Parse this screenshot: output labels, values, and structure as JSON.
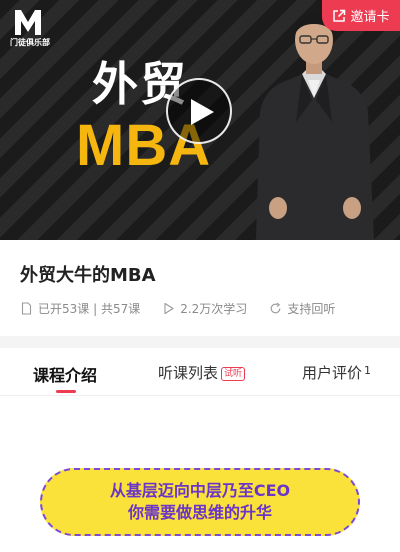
{
  "hero": {
    "logo_text": "门徒俱乐部",
    "title_cn": "外贸",
    "title_en": "MBA",
    "invite_label": "邀请卡"
  },
  "course": {
    "title": "外贸大牛的MBA",
    "lessons": "已开53课 | 共57课",
    "learners": "2.2万次学习",
    "replay": "支持回听"
  },
  "tabs": {
    "intro": "课程介绍",
    "list": "听课列表",
    "trial_badge": "试听",
    "reviews": "用户评价",
    "review_count": "1"
  },
  "promo": {
    "line1": "从基层迈向中层乃至CEO",
    "line2": "你需要做思维的升华"
  },
  "colors": {
    "accent": "#ed3c52",
    "mba_gold": "#f5b70f",
    "promo_yellow": "#fbe23b",
    "promo_purple": "#6a35c8"
  }
}
